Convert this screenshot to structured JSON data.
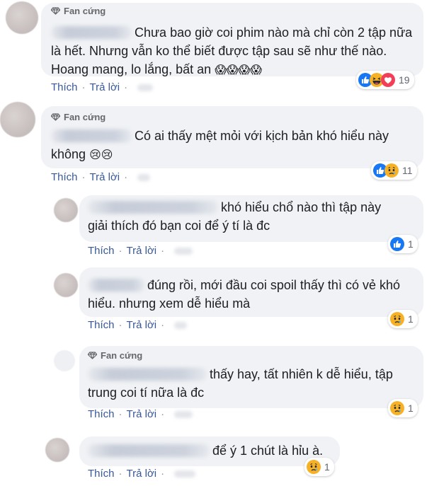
{
  "labels": {
    "like": "Thích",
    "reply": "Trả lời",
    "separator": "·"
  },
  "colors": {
    "link": "#385898",
    "bubble": "#f0f2f5",
    "like_blue": "#1877f2",
    "love_red": "#f33e58",
    "emoji_yellow": "#f7b125"
  },
  "comments": [
    {
      "badge": "Fan cứng",
      "lines": [
        "Chưa bao giờ coi phim nào mà chỉ còn 2 tập nữa",
        "là hết. Nhưng vẫn ko thể biết được tập sau sẽ như thế nào.",
        "Hoang mang, lo lắng, bất an"
      ],
      "emoji_suffix": "😱😱😱😱",
      "reaction_icons": [
        "like-reaction-icon",
        "haha-reaction-icon",
        "love-reaction-icon"
      ],
      "reaction_count": "19"
    },
    {
      "badge": "Fan cứng",
      "lines": [
        "Có ai thấy mệt mỏi với kịch bản khó hiểu này",
        "không"
      ],
      "emoji_suffix": "😢😢",
      "reaction_icons": [
        "like-reaction-icon",
        "sad-reaction-icon"
      ],
      "reaction_count": "11"
    },
    {
      "lines": [
        "khó hiểu chổ nào thì tập này",
        "giải thích đó bạn coi để ý tí là đc"
      ],
      "reaction_icons": [
        "like-reaction-icon"
      ],
      "reaction_count": "1"
    },
    {
      "lines": [
        "đúng rồi, mới đầu coi spoil thấy thì có vẻ khó",
        "hiểu. nhưng xem dễ hiểu mà"
      ],
      "reaction_icons": [
        "sad-reaction-icon"
      ],
      "reaction_count": "1"
    },
    {
      "badge": "Fan cứng",
      "lines": [
        "thấy hay, tất nhiên k dễ hiểu, tập",
        "trung coi tí nữa là đc"
      ],
      "reaction_icons": [
        "sad-reaction-icon"
      ],
      "reaction_count": "1"
    },
    {
      "lines": [
        "để ý 1 chút là hỉu à."
      ],
      "reaction_icons": [
        "sad-reaction-icon"
      ],
      "reaction_count": "1"
    }
  ]
}
